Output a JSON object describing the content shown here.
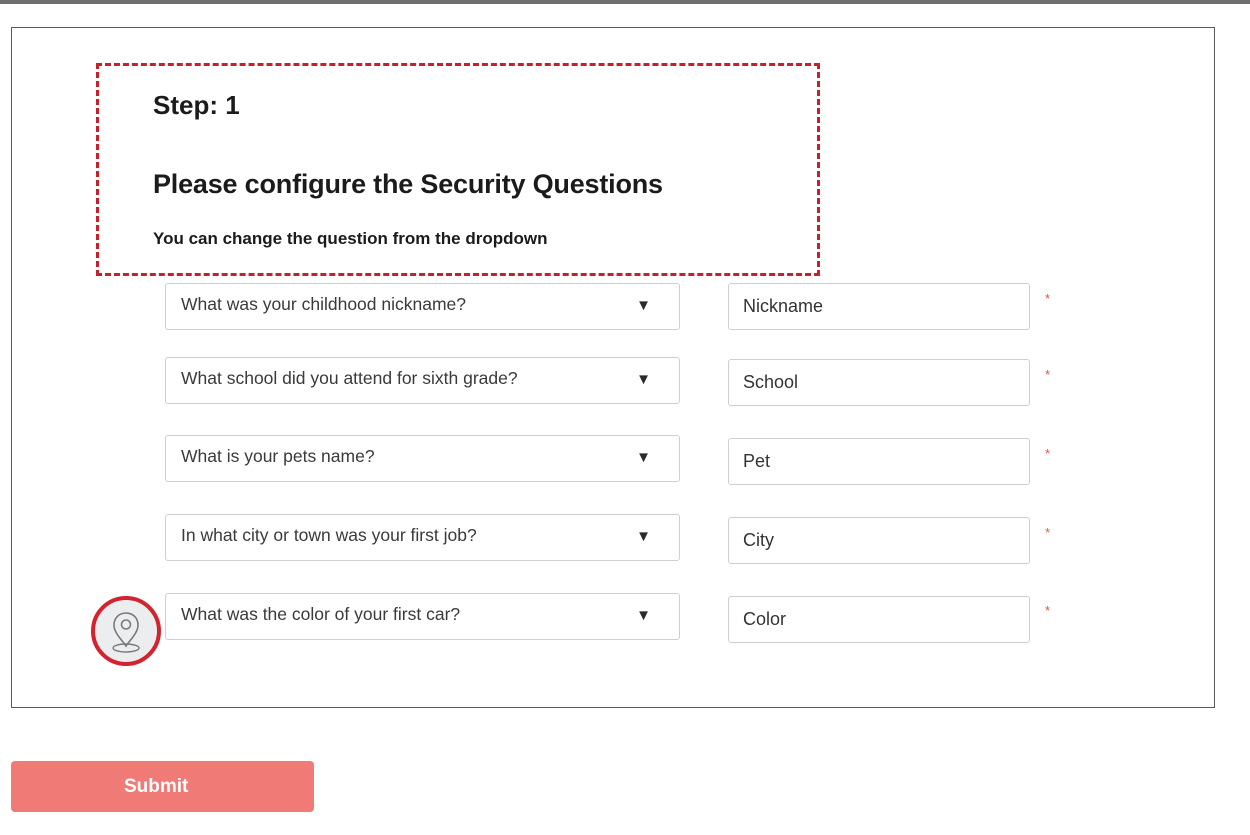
{
  "header": {
    "step": "Step: 1",
    "title": "Please configure the Security Questions",
    "subtitle": "You can change the question from the dropdown"
  },
  "questions": [
    {
      "question": "What was your childhood nickname?",
      "answer": "Nickname",
      "required_mark": "*"
    },
    {
      "question": "What school did you attend for sixth grade?",
      "answer": "School",
      "required_mark": "*"
    },
    {
      "question": "What is your pets name?",
      "answer": "Pet",
      "required_mark": "*"
    },
    {
      "question": "In what city or town was your first job?",
      "answer": "City",
      "required_mark": "*"
    },
    {
      "question": "What was the color of your first car?",
      "answer": "Color",
      "required_mark": "*"
    }
  ],
  "dropdown_caret": "▼",
  "submit_label": "Submit",
  "icons": {
    "location": "location-pin-icon"
  },
  "colors": {
    "highlight": "#c5202b",
    "required": "#e05555",
    "submit_bg": "#ef7a76"
  }
}
